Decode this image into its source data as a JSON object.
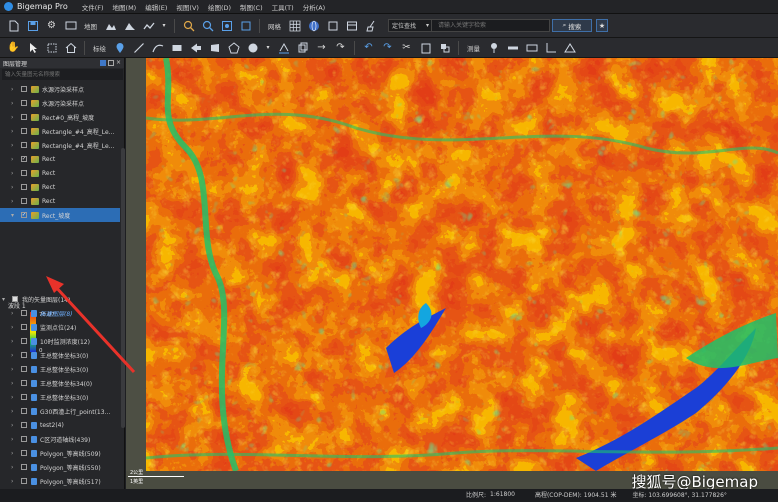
{
  "titlebar": {
    "app_title": "Bigemap Pro",
    "menus": [
      "文件(F)",
      "地图(M)",
      "编辑(E)",
      "视图(V)",
      "绘图(D)",
      "制图(C)",
      "工具(T)",
      "分析(A)"
    ]
  },
  "toolbar1": {
    "map_label": "地图",
    "grid_label": "网格",
    "location_select": "定位查找",
    "search_placeholder": "请输入关键字检索",
    "search_button": "搜索"
  },
  "toolbar2": {
    "mark_label": "标绘",
    "measure_label": "测量"
  },
  "layer_panel": {
    "title": "图层管理",
    "filter_placeholder": "输入矢量图元名称搜索",
    "raster_layers": [
      {
        "label": "水源污染采样点",
        "checked": false,
        "selected": false
      },
      {
        "label": "水源污染采样点",
        "checked": false,
        "selected": false
      },
      {
        "label": "Rect#0_高程_坡度",
        "checked": false,
        "selected": false
      },
      {
        "label": "Rectangle_#4_高程_Le...",
        "checked": false,
        "selected": false
      },
      {
        "label": "Rectangle_#4_高程_Le...",
        "checked": false,
        "selected": false
      },
      {
        "label": "Rect",
        "checked": true,
        "selected": false
      },
      {
        "label": "Rect",
        "checked": false,
        "selected": false
      },
      {
        "label": "Rect",
        "checked": false,
        "selected": false
      },
      {
        "label": "Rect",
        "checked": false,
        "selected": false
      },
      {
        "label": "Rect_坡度",
        "checked": true,
        "selected": true
      }
    ],
    "legend": {
      "band": "波段 1",
      "max": "75.07",
      "min": "0"
    },
    "vector_group": "我的矢量图层(14)",
    "vector_layers": [
      {
        "label": "新建图层(8)",
        "selected": true
      },
      {
        "label": "监测点位(24)",
        "selected": false
      },
      {
        "label": "10时监测浓度(12)",
        "selected": false
      },
      {
        "label": "王总整体坐标3(0)",
        "selected": false
      },
      {
        "label": "王总整体坐标3(0)",
        "selected": false
      },
      {
        "label": "王总整体坐标34(0)",
        "selected": false
      },
      {
        "label": "王总整体坐标3(0)",
        "selected": false
      },
      {
        "label": "G30西潼上行_point(13...",
        "selected": false
      },
      {
        "label": "test2(4)",
        "selected": false
      },
      {
        "label": "C区河道轴线(439)",
        "selected": false
      },
      {
        "label": "Polygon_等高线(509)",
        "selected": false
      },
      {
        "label": "Polygon_等高线(550)",
        "selected": false
      },
      {
        "label": "Polygon_等高线(517)",
        "selected": false
      },
      {
        "label": "王总整体坐标(116)",
        "selected": false
      }
    ]
  },
  "map": {
    "scale_text": "2公里",
    "scale_text2": "1英里"
  },
  "status": {
    "scale_label": "比例尺:",
    "scale_value": "1:61800",
    "elevation": "高程(COP-DEM): 1904.51 米",
    "coords": "坐标: 103.699608°, 31.177826°"
  },
  "watermark": "搜狐号@Bigemap",
  "colors": {
    "accent": "#2c6db5",
    "legend_top": "#e8241a",
    "legend_mid": "#f5e800",
    "legend_bottom": "#1a2fd4"
  }
}
